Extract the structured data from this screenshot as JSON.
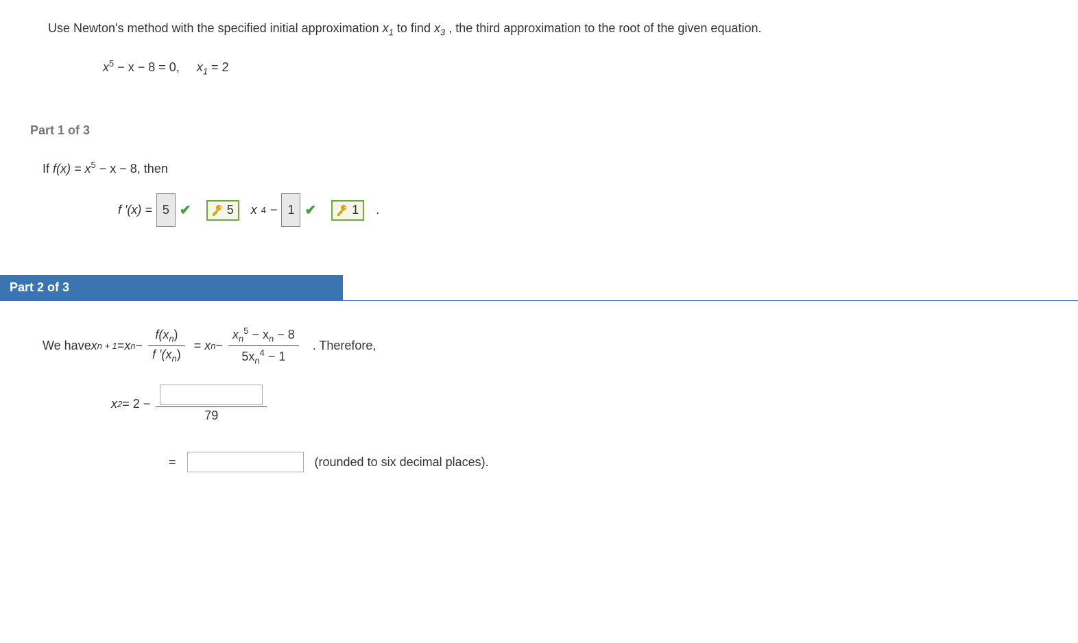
{
  "problem": {
    "intro_text_a": "Use Newton's method with the specified initial approximation ",
    "intro_text_b": " to find ",
    "intro_text_c": ", the third approximation to the root of the given equation.",
    "x1_var": "x",
    "x1_sub": "1",
    "x3_var": "x",
    "x3_sub": "3",
    "equation_lhs": "x",
    "equation_exp": "5",
    "equation_mid": " − x − 8 = 0,",
    "ic_var": "x",
    "ic_sub": "1",
    "ic_val": " = 2"
  },
  "part1": {
    "label": "Part 1 of 3",
    "if_a": "If  ",
    "fx": "f(x) = x",
    "fx_exp": "5",
    "fx_tail": " − x − 8,  then",
    "fprime": "f ′(x)  = ",
    "ans1": "5",
    "mid_x": "x",
    "mid_exp": "4",
    "mid_minus": " − ",
    "ans2": "1",
    "key1": "5",
    "key2": "1",
    "period": "."
  },
  "part2": {
    "label": "Part 2 of 3",
    "wehave": "We have  ",
    "xn1_var": "x",
    "xn1_sub": "n + 1",
    "eq": " = ",
    "xn_var": "x",
    "xn_sub": "n",
    "minus": " − ",
    "numer1_a": "f(x",
    "numer1_b": ")",
    "denom1_a": "f ′(x",
    "denom1_b": ")",
    "numer2_pre": "x",
    "numer2_sub": "n",
    "numer2_exp": "5",
    "numer2_mid": " − x",
    "numer2_tail": " − 8",
    "denom2_a": "5x",
    "denom2_sub": "n",
    "denom2_exp": "4",
    "denom2_tail": " − 1",
    "therefore": ".  Therefore,",
    "x2_var": "x",
    "x2_sub": "2",
    "x2_eq": " = 2 − ",
    "den_val": "79",
    "eq_symbol": "=",
    "rounded": "(rounded to six decimal places)."
  }
}
